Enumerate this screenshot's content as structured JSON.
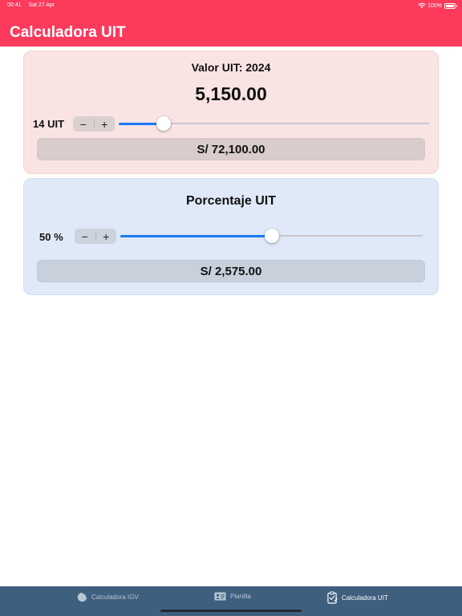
{
  "status_bar": {
    "time": "00:41",
    "date": "Sat 27 Apr",
    "battery": "100%"
  },
  "header": {
    "title": "Calculadora UIT"
  },
  "uit_card": {
    "year_label": "Valor UIT: 2024",
    "uit_value": "5,150.00",
    "quantity_label": "14 UIT",
    "decrement": "−",
    "increment": "+",
    "slider_fraction": 0.145,
    "result": "S/ 72,100.00"
  },
  "percent_card": {
    "title": "Porcentaje UIT",
    "percent_label": "50 %",
    "decrement": "−",
    "increment": "+",
    "slider_fraction": 0.5,
    "result": "S/ 2,575.00"
  },
  "tabs": [
    {
      "label": "Calculadora IGV",
      "icon": "pie-chart-icon",
      "active": false
    },
    {
      "label": "Planilla",
      "icon": "id-card-icon",
      "active": false
    },
    {
      "label": "Calculadora UIT",
      "icon": "clipboard-icon",
      "active": true
    }
  ],
  "colors": {
    "accent": "#fb3a5c",
    "slider_fill": "#1a7af6",
    "tabbar": "#3f5f7e"
  }
}
